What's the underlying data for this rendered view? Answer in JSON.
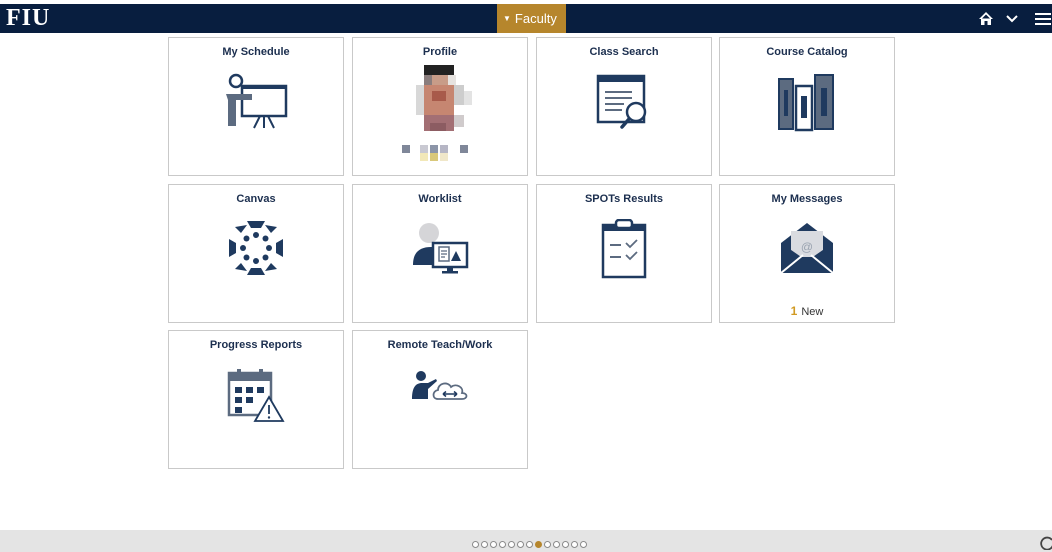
{
  "header": {
    "logo_text": "FIU",
    "nav_label": "Faculty",
    "home_icon": "home-icon",
    "chevron_icon": "chevron-down-icon",
    "menu_icon": "hamburger-menu-icon"
  },
  "tiles": [
    {
      "title": "My Schedule",
      "icon": "presentation-board-icon"
    },
    {
      "title": "Profile",
      "icon": "profile-photo"
    },
    {
      "title": "Class Search",
      "icon": "document-search-icon"
    },
    {
      "title": "Course Catalog",
      "icon": "books-icon"
    },
    {
      "title": "Canvas",
      "icon": "canvas-logo-icon"
    },
    {
      "title": "Worklist",
      "icon": "person-monitor-icon"
    },
    {
      "title": "SPOTs Results",
      "icon": "clipboard-checklist-icon"
    },
    {
      "title": "My Messages",
      "icon": "envelope-icon",
      "badge_count": "1",
      "badge_label": "New"
    },
    {
      "title": "Progress Reports",
      "icon": "calendar-warning-icon"
    },
    {
      "title": "Remote Teach/Work",
      "icon": "teacher-cloud-icon"
    }
  ],
  "pager": {
    "total": 13,
    "active": 8
  },
  "colors": {
    "navy": "#081e3f",
    "gold": "#b6862c",
    "icon_navy": "#1f3a5f",
    "icon_gray": "#5c6b80"
  }
}
